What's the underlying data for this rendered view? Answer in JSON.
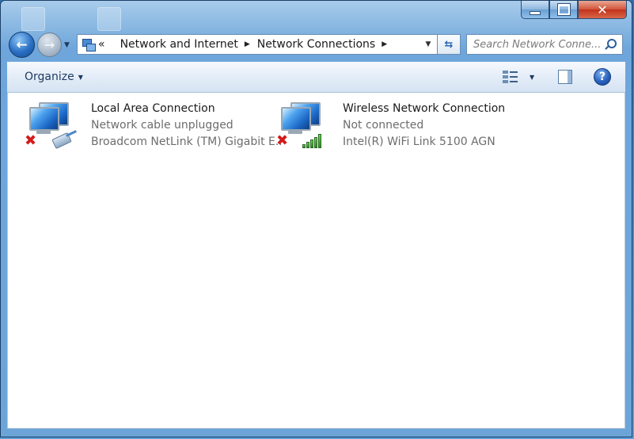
{
  "window": {
    "close_glyph": "✕"
  },
  "nav": {
    "back_icon": "back-arrow-icon",
    "forward_icon": "forward-arrow-icon"
  },
  "address": {
    "overflow": "«",
    "crumbs": [
      "Network and Internet",
      "Network Connections"
    ]
  },
  "search": {
    "placeholder": "Search Network Conne..."
  },
  "toolbar": {
    "organize_label": "Organize",
    "help_label": "?"
  },
  "connections": [
    {
      "name": "Local Area Connection",
      "status": "Network cable unplugged",
      "device": "Broadcom NetLink (TM) Gigabit E...",
      "badge": "disconnected",
      "type": "ethernet"
    },
    {
      "name": "Wireless Network Connection",
      "status": "Not connected",
      "device": "Intel(R) WiFi Link 5100 AGN",
      "badge": "disconnected",
      "type": "wireless"
    }
  ],
  "colors": {
    "accent": "#2a6fc4",
    "error": "#d31a1a",
    "signal": "#2f8b25"
  }
}
